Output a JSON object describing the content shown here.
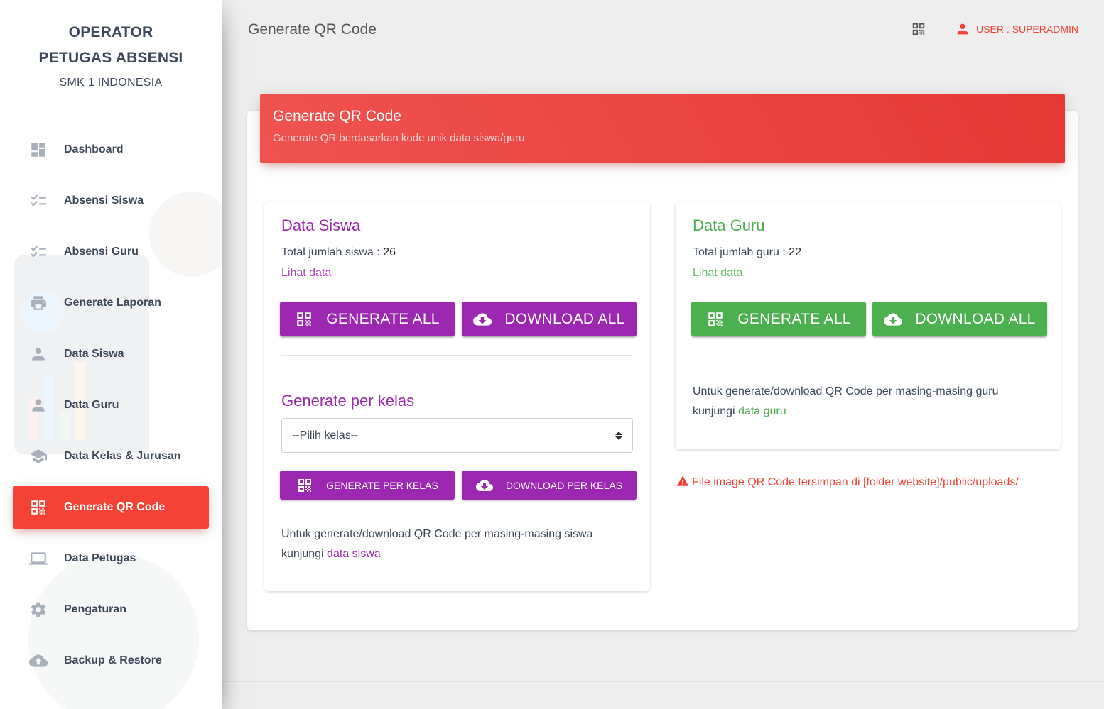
{
  "sidebar": {
    "brand_line1": "OPERATOR",
    "brand_line2": "PETUGAS ABSENSI",
    "brand_sub": "SMK 1 INDONESIA",
    "items": [
      {
        "label": "Dashboard",
        "icon": "dashboard-icon"
      },
      {
        "label": "Absensi Siswa",
        "icon": "checklist-icon"
      },
      {
        "label": "Absensi Guru",
        "icon": "checklist-icon"
      },
      {
        "label": "Generate Laporan",
        "icon": "print-icon"
      },
      {
        "label": "Data Siswa",
        "icon": "person-icon"
      },
      {
        "label": "Data Guru",
        "icon": "person-icon"
      },
      {
        "label": "Data Kelas & Jurusan",
        "icon": "school-icon"
      },
      {
        "label": "Generate QR Code",
        "icon": "qr-code-icon",
        "active": true
      },
      {
        "label": "Data Petugas",
        "icon": "laptop-icon"
      },
      {
        "label": "Pengaturan",
        "icon": "gear-icon"
      },
      {
        "label": "Backup & Restore",
        "icon": "cloud-upload-icon"
      }
    ]
  },
  "topbar": {
    "title": "Generate QR Code",
    "user": "USER : SUPERADMIN"
  },
  "card": {
    "title": "Generate QR Code",
    "subtitle": "Generate QR berdasarkan kode unik data siswa/guru"
  },
  "siswa": {
    "title": "Data Siswa",
    "total_label": "Total jumlah siswa : ",
    "total_value": "26",
    "link": "Lihat data",
    "generate_all": "GENERATE ALL",
    "download_all": "DOWNLOAD ALL",
    "per_kelas_title": "Generate per kelas",
    "select_placeholder": "--Pilih kelas--",
    "generate_per_kelas": "GENERATE PER KELAS",
    "download_per_kelas": "DOWNLOAD PER KELAS",
    "note_text": "Untuk generate/download QR Code per masing-masing siswa",
    "note_prefix": "kunjungi ",
    "note_link": "data siswa"
  },
  "guru": {
    "title": "Data Guru",
    "total_label": "Total jumlah guru : ",
    "total_value": "22",
    "link": "Lihat data",
    "generate_all": "GENERATE ALL",
    "download_all": "DOWNLOAD ALL",
    "note_text": "Untuk generate/download QR Code per masing-masing guru",
    "note_prefix": "kunjungi ",
    "note_link": "data guru"
  },
  "warning": "File image QR Code tersimpan di [folder website]/public/uploads/",
  "colors": {
    "accent_red": "#f44336",
    "purple": "#9c27b0",
    "green": "#4caf50"
  }
}
